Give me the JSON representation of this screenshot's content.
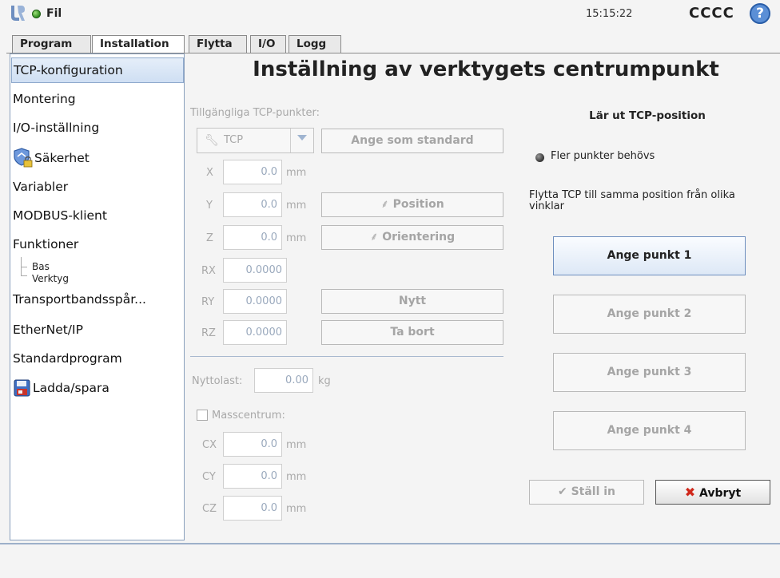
{
  "header": {
    "menu_label": "Fil",
    "time": "15:15:22",
    "robot_name": "CCCC",
    "help_glyph": "?"
  },
  "tabs": [
    {
      "label": "Program"
    },
    {
      "label": "Installation"
    },
    {
      "label": "Flytta"
    },
    {
      "label": "I/O"
    },
    {
      "label": "Logg"
    }
  ],
  "sidebar": {
    "items": [
      {
        "label": "TCP-konfiguration"
      },
      {
        "label": "Montering"
      },
      {
        "label": "I/O-inställning"
      },
      {
        "label": "Säkerhet"
      },
      {
        "label": "Variabler"
      },
      {
        "label": "MODBUS-klient"
      },
      {
        "label": "Funktioner"
      },
      {
        "label": "Transportbandsspår..."
      },
      {
        "label": "EtherNet/IP"
      },
      {
        "label": "Standardprogram"
      },
      {
        "label": "Ladda/spara"
      }
    ],
    "sub_items": [
      {
        "label": "Bas"
      },
      {
        "label": "Verktyg"
      }
    ]
  },
  "main": {
    "title": "Inställning av verktygets centrumpunkt",
    "tcp_points_label": "Tillgängliga TCP-punkter:",
    "tcp_selected": "TCP",
    "set_default_label": "Ange som standard",
    "fields": {
      "x": {
        "label": "X",
        "value": "0.0",
        "unit": "mm"
      },
      "y": {
        "label": "Y",
        "value": "0.0",
        "unit": "mm"
      },
      "z": {
        "label": "Z",
        "value": "0.0",
        "unit": "mm"
      },
      "rx": {
        "label": "RX",
        "value": "0.0000"
      },
      "ry": {
        "label": "RY",
        "value": "0.0000"
      },
      "rz": {
        "label": "RZ",
        "value": "0.0000"
      }
    },
    "position_label": "Position",
    "orientation_label": "Orientering",
    "new_label": "Nytt",
    "remove_label": "Ta bort",
    "payload": {
      "label": "Nyttolast:",
      "value": "0.00",
      "unit": "kg"
    },
    "cog_label": "Masscentrum:",
    "cog": {
      "cx": {
        "label": "CX",
        "value": "0.0",
        "unit": "mm"
      },
      "cy": {
        "label": "CY",
        "value": "0.0",
        "unit": "mm"
      },
      "cz": {
        "label": "CZ",
        "value": "0.0",
        "unit": "mm"
      }
    }
  },
  "teach": {
    "title": "Lär ut TCP-position",
    "status": "Fler punkter behövs",
    "instruction": "Flytta TCP till samma position från olika vinklar",
    "points": [
      {
        "label": "Ange punkt 1"
      },
      {
        "label": "Ange punkt 2"
      },
      {
        "label": "Ange punkt 3"
      },
      {
        "label": "Ange punkt 4"
      }
    ],
    "set_label": "Ställ in",
    "cancel_label": "Avbryt"
  },
  "colors": {
    "accent": "#5b8fd6",
    "selected_bg": "#d6e4f5",
    "ok_status": "#3da82a",
    "cancel_x": "#d0281b"
  }
}
